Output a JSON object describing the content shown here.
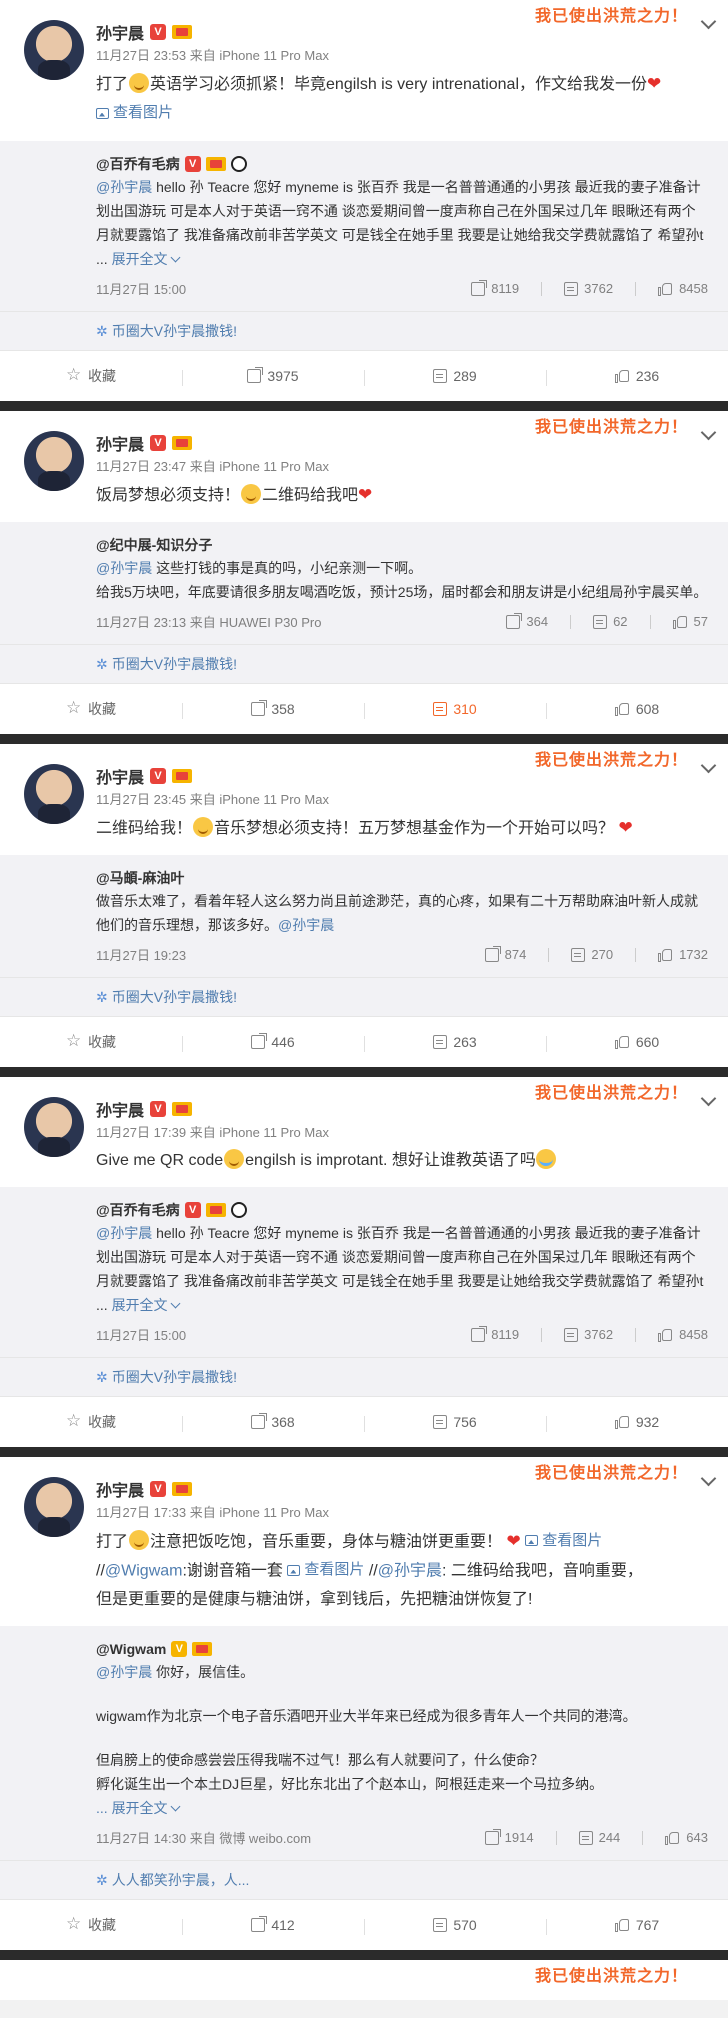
{
  "colors": {
    "accent": "#f2672a",
    "link": "#507daf",
    "verified": "#e8423a",
    "divider": "#2b2b2b"
  },
  "banner": "我已使出洪荒之力！",
  "posts": [
    {
      "author": "孙宇晨",
      "time": "11月27日 23:53",
      "source": "来自 iPhone 11 Pro Max",
      "text_a": "打了",
      "text_b": "英语学习必须抓紧！毕竟engilsh is very intrenational，作文给我发一份",
      "pic_label": "查看图片",
      "repost": {
        "author": "@百乔有毛病",
        "mention": "@孙宇晨",
        "text": " hello 孙 Teacre 您好   myneme is  张百乔   我是一名普普通通的小男孩   最近我的妻子准备计划出国游玩   可是本人对于英语一窍不通   谈恋爱期间曾一度声称自己在外国呆过几年  眼瞅还有两个月就要露馅了  我准备痛改前非苦学英文  可是钱全在她手里 我要是让她给我交学费就露馅了 希望孙t ...",
        "more": "展开全文",
        "time": "11月27日 15:00",
        "forward": "8119",
        "comment": "3762",
        "like": "8458"
      },
      "topic": "币圈大V孙宇晨撒钱!",
      "actions": {
        "fav": "收藏",
        "forward": "3975",
        "comment": "289",
        "like": "236"
      }
    },
    {
      "author": "孙宇晨",
      "time": "11月27日 23:47",
      "source": "来自 iPhone 11 Pro Max",
      "text_a": "饭局梦想必须支持！",
      "text_b": "二维码给我吧",
      "repost": {
        "author": "@纪中展-知识分子",
        "mention": "@孙宇晨",
        "text": " 这些打钱的事是真的吗，小纪亲测一下啊。",
        "text2": "给我5万块吧，年底要请很多朋友喝酒吃饭，预计25场，届时都会和朋友讲是小纪组局孙宇晨买单。",
        "time": "11月27日 23:13 来自 HUAWEI P30 Pro",
        "forward": "364",
        "comment": "62",
        "like": "57"
      },
      "topic": "币圈大V孙宇晨撒钱!",
      "actions": {
        "fav": "收藏",
        "forward": "358",
        "comment": "310",
        "like": "608"
      }
    },
    {
      "author": "孙宇晨",
      "time": "11月27日 23:45",
      "source": "来自 iPhone 11 Pro Max",
      "text_a": "二维码给我！",
      "text_b": "音乐梦想必须支持！五万梦想基金作为一个开始可以吗？",
      "repost": {
        "author": "@马頔-麻油叶",
        "text": "做音乐太难了，看着年轻人这么努力尚且前途渺茫，真的心疼，如果有二十万帮助麻油叶新人成就他们的音乐理想，那该多好。",
        "mention": "@孙宇晨",
        "time": "11月27日 19:23",
        "forward": "874",
        "comment": "270",
        "like": "1732"
      },
      "topic": "币圈大V孙宇晨撒钱!",
      "actions": {
        "fav": "收藏",
        "forward": "446",
        "comment": "263",
        "like": "660"
      }
    },
    {
      "author": "孙宇晨",
      "time": "11月27日 17:39",
      "source": "来自 iPhone 11 Pro Max",
      "text_a": "Give me QR code",
      "text_b": "engilsh is improtant. 想好让谁教英语了吗",
      "repost": {
        "author": "@百乔有毛病",
        "mention": "@孙宇晨",
        "text": " hello 孙 Teacre 您好   myneme is  张百乔   我是一名普普通通的小男孩   最近我的妻子准备计划出国游玩   可是本人对于英语一窍不通   谈恋爱期间曾一度声称自己在外国呆过几年  眼瞅还有两个月就要露馅了  我准备痛改前非苦学英文  可是钱全在她手里 我要是让她给我交学费就露馅了 希望孙t ...",
        "more": "展开全文",
        "time": "11月27日 15:00",
        "forward": "8119",
        "comment": "3762",
        "like": "8458"
      },
      "topic": "币圈大V孙宇晨撒钱!",
      "actions": {
        "fav": "收藏",
        "forward": "368",
        "comment": "756",
        "like": "932"
      }
    },
    {
      "author": "孙宇晨",
      "time": "11月27日 17:33",
      "source": "来自 iPhone 11 Pro Max",
      "text_a": "打了",
      "text_b": "注意把饭吃饱，音乐重要，身体与糖油饼更重要！",
      "pic_label": "查看图片",
      "line2_a": "//",
      "line2_mention": "@Wigwam",
      "line2_b": ":谢谢音箱一套 ",
      "pic_label2": "查看图片",
      "line2_c": " //",
      "line2_mention2": "@孙宇晨",
      "line2_d": ": 二维码给我吧，音响重要，",
      "line3": "但是更重要的是健康与糖油饼，拿到钱后，先把糖油饼恢复了!",
      "repost": {
        "author": "@Wigwam",
        "mention": "@孙宇晨",
        "text": " 你好，展信佳。",
        "p1": "wigwam作为北京一个电子音乐酒吧开业大半年来已经成为很多青年人一个共同的港湾。",
        "p2": "但肩膀上的使命感尝尝压得我喘不过气！那么有人就要问了，什么使命？",
        "p3": "孵化诞生出一个本土DJ巨星，好比东北出了个赵本山，阿根廷走来一个马拉多纳。",
        "more": "展开全文",
        "time": "11月27日 14:30 来自 微博 weibo.com",
        "forward": "1914",
        "comment": "244",
        "like": "643"
      },
      "topic": "人人都笑孙宇晨，人...",
      "actions": {
        "fav": "收藏",
        "forward": "412",
        "comment": "570",
        "like": "767"
      }
    }
  ]
}
